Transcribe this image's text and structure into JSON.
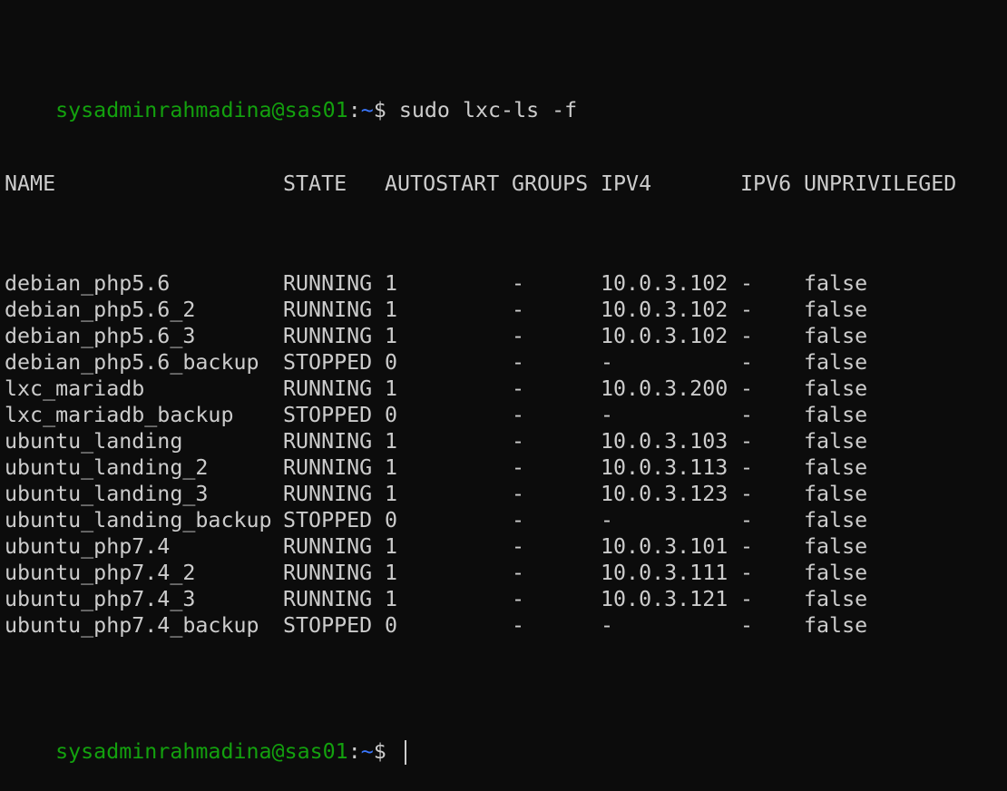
{
  "prompt": {
    "user_host": "sysadminrahmadina@sas01",
    "separator": ":",
    "path": "~",
    "symbol": "$ "
  },
  "command": "sudo lxc-ls -f",
  "table": {
    "headers": [
      "NAME",
      "STATE",
      "AUTOSTART",
      "GROUPS",
      "IPV4",
      "IPV6",
      "UNPRIVILEGED"
    ],
    "rows": [
      [
        "debian_php5.6",
        "RUNNING",
        "1",
        "-",
        "10.0.3.102",
        "-",
        "false"
      ],
      [
        "debian_php5.6_2",
        "RUNNING",
        "1",
        "-",
        "10.0.3.102",
        "-",
        "false"
      ],
      [
        "debian_php5.6_3",
        "RUNNING",
        "1",
        "-",
        "10.0.3.102",
        "-",
        "false"
      ],
      [
        "debian_php5.6_backup",
        "STOPPED",
        "0",
        "-",
        "-",
        "-",
        "false"
      ],
      [
        "lxc_mariadb",
        "RUNNING",
        "1",
        "-",
        "10.0.3.200",
        "-",
        "false"
      ],
      [
        "lxc_mariadb_backup",
        "STOPPED",
        "0",
        "-",
        "-",
        "-",
        "false"
      ],
      [
        "ubuntu_landing",
        "RUNNING",
        "1",
        "-",
        "10.0.3.103",
        "-",
        "false"
      ],
      [
        "ubuntu_landing_2",
        "RUNNING",
        "1",
        "-",
        "10.0.3.113",
        "-",
        "false"
      ],
      [
        "ubuntu_landing_3",
        "RUNNING",
        "1",
        "-",
        "10.0.3.123",
        "-",
        "false"
      ],
      [
        "ubuntu_landing_backup",
        "STOPPED",
        "0",
        "-",
        "-",
        "-",
        "false"
      ],
      [
        "ubuntu_php7.4",
        "RUNNING",
        "1",
        "-",
        "10.0.3.101",
        "-",
        "false"
      ],
      [
        "ubuntu_php7.4_2",
        "RUNNING",
        "1",
        "-",
        "10.0.3.111",
        "-",
        "false"
      ],
      [
        "ubuntu_php7.4_3",
        "RUNNING",
        "1",
        "-",
        "10.0.3.121",
        "-",
        "false"
      ],
      [
        "ubuntu_php7.4_backup",
        "STOPPED",
        "0",
        "-",
        "-",
        "-",
        "false"
      ]
    ]
  },
  "colors": {
    "background": "#0c0c0c",
    "foreground": "#cccccc",
    "user_host": "#13a10e",
    "path": "#3b78ff"
  }
}
